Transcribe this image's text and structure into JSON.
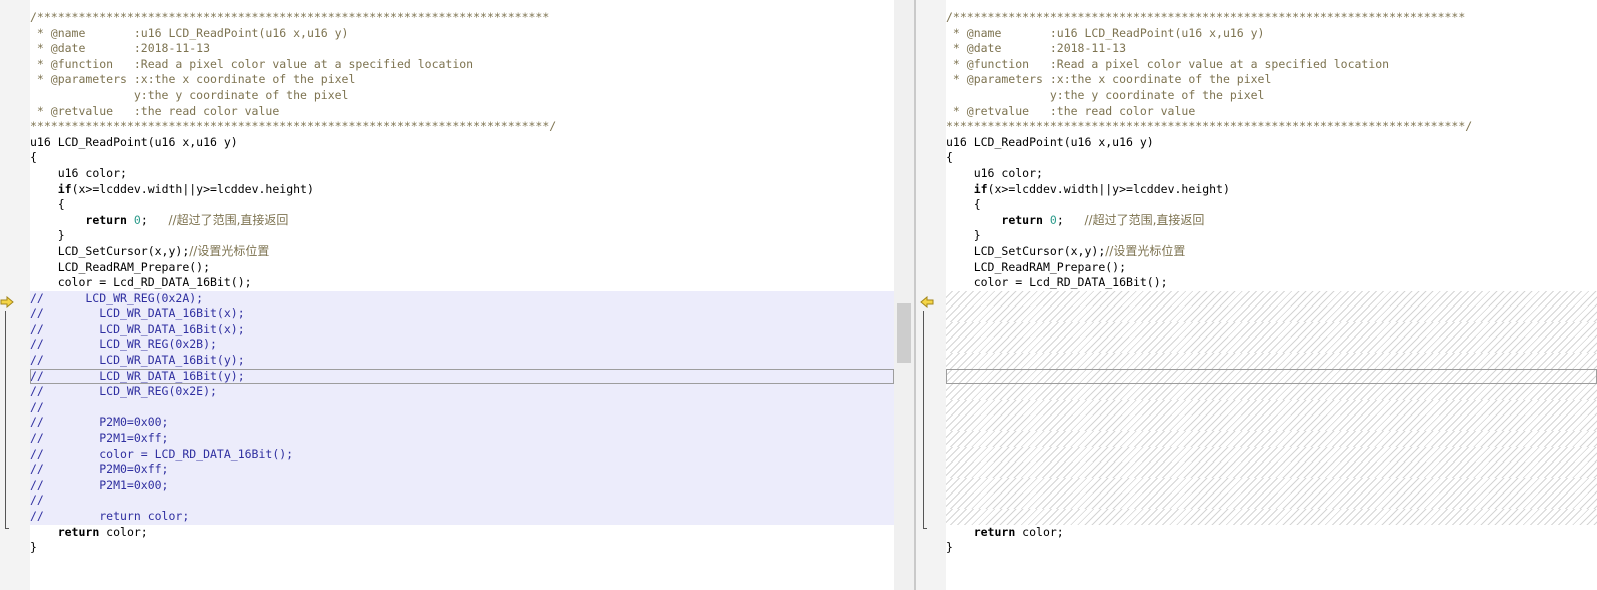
{
  "icons": {
    "diff_marker": "arrow-right-icon"
  },
  "colors": {
    "deleted_bg": "#ececfb",
    "comment": "#7d7350",
    "number": "#2a9a8a"
  },
  "left": {
    "lines": [
      "/**************************************************************************",
      " * @name       :u16 LCD_ReadPoint(u16 x,u16 y)",
      " * @date       :2018-11-13",
      " * @function   :Read a pixel color value at a specified location",
      " * @parameters :x:the x coordinate of the pixel",
      "               y:the y coordinate of the pixel",
      " * @retvalue   :the read color value",
      "***************************************************************************/",
      "u16 LCD_ReadPoint(u16 x,u16 y)",
      "{",
      "u16 color;",
      "if",
      "(x>=lcddev.width||y>=lcddev.height)",
      "{",
      "return",
      "0",
      ";   ",
      "//超过了范围,直接返回",
      "}",
      "LCD_SetCursor(x,y);",
      "//设置光标位置",
      "LCD_ReadRAM_Prepare();",
      "color = Lcd_RD_DATA_16Bit();",
      "//      LCD_WR_REG(0x2A);",
      "//        LCD_WR_DATA_16Bit(x);",
      "//        LCD_WR_DATA_16Bit(x);",
      "//        LCD_WR_REG(0x2B);",
      "//        LCD_WR_DATA_16Bit(y);",
      "//        LCD_WR_DATA_16Bit(y);",
      "//        LCD_WR_REG(0x2E);",
      "//",
      "//        P2M0=0x00;",
      "//        P2M1=0xff;",
      "//        color = LCD_RD_DATA_16Bit();",
      "//        P2M0=0xff;",
      "//        P2M1=0x00;",
      "//",
      "//        return color;",
      "return",
      " color;",
      "}"
    ]
  },
  "right": {
    "lines": [
      "/**************************************************************************",
      " * @name       :u16 LCD_ReadPoint(u16 x,u16 y)",
      " * @date       :2018-11-13",
      " * @function   :Read a pixel color value at a specified location",
      " * @parameters :x:the x coordinate of the pixel",
      "               y:the y coordinate of the pixel",
      " * @retvalue   :the read color value",
      "***************************************************************************/",
      "u16 LCD_ReadPoint(u16 x,u16 y)",
      "{",
      "u16 color;",
      "if",
      "(x>=lcddev.width||y>=lcddev.height)",
      "{",
      "return",
      "0",
      ";   ",
      "//超过了范围,直接返回",
      "}",
      "LCD_SetCursor(x,y);",
      "//设置光标位置",
      "LCD_ReadRAM_Prepare();",
      "color = Lcd_RD_DATA_16Bit();",
      "return",
      " color;",
      "}"
    ]
  }
}
